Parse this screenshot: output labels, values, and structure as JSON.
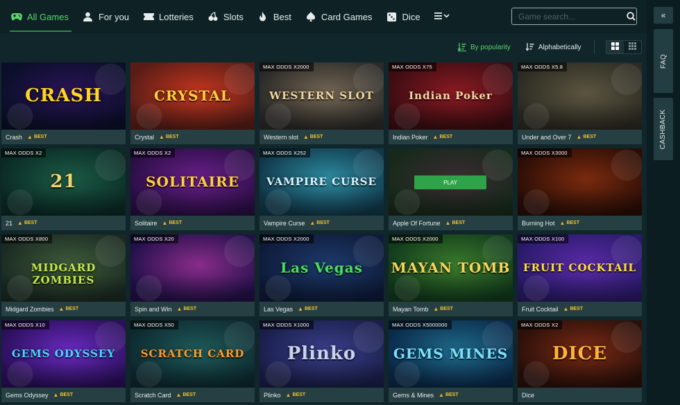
{
  "nav": {
    "tabs": [
      {
        "label": "All Games",
        "icon": "gamepad-icon",
        "active": true
      },
      {
        "label": "For you",
        "icon": "user-icon"
      },
      {
        "label": "Lotteries",
        "icon": "ticket-icon"
      },
      {
        "label": "Slots",
        "icon": "slots-icon"
      },
      {
        "label": "Best",
        "icon": "fire-icon"
      },
      {
        "label": "Card Games",
        "icon": "spade-icon"
      },
      {
        "label": "Dice",
        "icon": "dice-icon"
      }
    ],
    "more_icon": "menu-chevron-icon",
    "search_placeholder": "Game search..."
  },
  "sort": {
    "popularity": "By popularity",
    "alpha": "Alphabetically",
    "active": "popularity"
  },
  "sidebar": {
    "collapse": "«",
    "faq": "FAQ",
    "cashback": "CASHBACK"
  },
  "best_label": "BEST",
  "play_label": "PLAY",
  "games": [
    {
      "name": "Crash",
      "odds": "",
      "best": true,
      "art": "CRASH",
      "bg": "#0b0f2a",
      "bg2": "#2b1358",
      "fg": "#ffd42a"
    },
    {
      "name": "Crystal",
      "odds": "",
      "best": true,
      "art": "CRYSTAL",
      "bg": "#5a1d16",
      "bg2": "#c4361f",
      "fg": "#ffce3a"
    },
    {
      "name": "Western slot",
      "odds": "MAX ODDS X2000",
      "best": true,
      "art": "WESTERN SLOT",
      "bg": "#2b2a28",
      "bg2": "#736653",
      "fg": "#f0d7a0"
    },
    {
      "name": "Indian Poker",
      "odds": "MAX ODDS X75",
      "best": true,
      "art": "Indian Poker",
      "bg": "#3a0d12",
      "bg2": "#8b1a22",
      "fg": "#f6d6a3"
    },
    {
      "name": "Under and Over 7",
      "odds": "MAX ODDS X5.8",
      "best": true,
      "art": "",
      "bg": "#2c2a22",
      "bg2": "#5b5540",
      "fg": "#eeeeee"
    },
    {
      "name": "21",
      "odds": "MAX ODDS X2",
      "best": true,
      "art": "21",
      "bg": "#0a2a24",
      "bg2": "#1b5a44",
      "fg": "#f6d36a"
    },
    {
      "name": "Solitaire",
      "odds": "MAX ODDS X2",
      "best": true,
      "art": "SOLITAIRE",
      "bg": "#2a0e45",
      "bg2": "#6a1f8a",
      "fg": "#ffcf3d"
    },
    {
      "name": "Vampire Curse",
      "odds": "MAX ODDS X252",
      "best": true,
      "art": "VAMPIRE CURSE",
      "bg": "#10384a",
      "bg2": "#2d8aa0",
      "fg": "#d8f4ff"
    },
    {
      "name": "Apple Of Fortune",
      "odds": "",
      "best": true,
      "art": "",
      "bg": "#172a1a",
      "bg2": "#3a2b33",
      "fg": "#ffffff"
    },
    {
      "name": "Burning Hot",
      "odds": "MAX ODDS X3000",
      "best": true,
      "art": "",
      "bg": "#2a0d06",
      "bg2": "#7a2a0e",
      "fg": "#ffcc44"
    },
    {
      "name": "Midgard Zombies",
      "odds": "MAX ODDS X800",
      "best": true,
      "art": "MIDGARD ZOMBIES",
      "bg": "#1a2a22",
      "bg2": "#3f5a3a",
      "fg": "#c6ea4a"
    },
    {
      "name": "Spin and Win",
      "odds": "MAX ODDS X20",
      "best": true,
      "art": "",
      "bg": "#22104a",
      "bg2": "#8a2c8a",
      "fg": "#ffd23a"
    },
    {
      "name": "Las Vegas",
      "odds": "MAX ODDS X2000",
      "best": true,
      "art": "Las Vegas",
      "bg": "#0e1a3a",
      "bg2": "#1d3a6a",
      "fg": "#48e05a"
    },
    {
      "name": "Mayan Tomb",
      "odds": "MAX ODDS X2000",
      "best": true,
      "art": "MAYAN TOMB",
      "bg": "#123a1c",
      "bg2": "#3a7a2a",
      "fg": "#f6d45a"
    },
    {
      "name": "Fruit Cocktail",
      "odds": "MAX ODDS X100",
      "best": true,
      "art": "FRUIT COCKTAIL",
      "bg": "#2a1a6a",
      "bg2": "#5a2aa8",
      "fg": "#ffe23a"
    },
    {
      "name": "Gems Odyssey",
      "odds": "MAX ODDS X10",
      "best": true,
      "art": "GEMS ODYSSEY",
      "bg": "#2a0f5a",
      "bg2": "#6a2ac0",
      "fg": "#49d6ff"
    },
    {
      "name": "Scratch Card",
      "odds": "MAX ODDS X50",
      "best": true,
      "art": "SCRATCH CARD",
      "bg": "#0d2a30",
      "bg2": "#1f5a5a",
      "fg": "#ff9a2a"
    },
    {
      "name": "Plinko",
      "odds": "MAX ODDS X1000",
      "best": true,
      "art": "Plinko",
      "bg": "#1a1e4a",
      "bg2": "#3a3f8a",
      "fg": "#c9d3ea"
    },
    {
      "name": "Gems & Mines",
      "odds": "MAX ODDS X5000000",
      "best": true,
      "art": "GEMS MINES",
      "bg": "#0a2a4a",
      "bg2": "#1f6a8a",
      "fg": "#7ae0ff"
    },
    {
      "name": "Dice",
      "odds": "MAX ODDS X2",
      "best": false,
      "art": "DICE",
      "bg": "#2a0f0a",
      "bg2": "#7a2a14",
      "fg": "#ffb23a"
    }
  ]
}
